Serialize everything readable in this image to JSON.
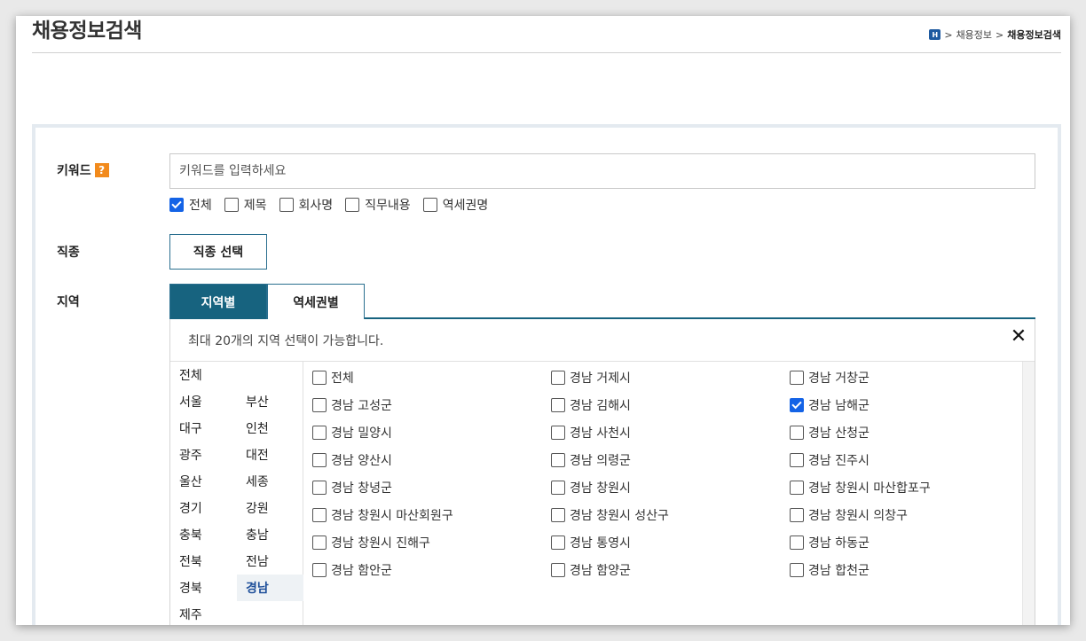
{
  "page_title": "채용정보검색",
  "breadcrumb": {
    "home_glyph": "H",
    "items": [
      "채용정보",
      "채용정보검색"
    ]
  },
  "keyword": {
    "label": "키워드",
    "help_glyph": "?",
    "placeholder": "키워드를 입력하세요",
    "options": [
      {
        "label": "전체",
        "checked": true
      },
      {
        "label": "제목",
        "checked": false
      },
      {
        "label": "회사명",
        "checked": false
      },
      {
        "label": "직무내용",
        "checked": false
      },
      {
        "label": "역세권명",
        "checked": false
      }
    ]
  },
  "job": {
    "label": "직종",
    "button_label": "직종 선택"
  },
  "region": {
    "label": "지역",
    "tabs": [
      {
        "label": "지역별",
        "active": true
      },
      {
        "label": "역세권별",
        "active": false
      }
    ],
    "notice": "최대 20개의 지역 선택이 가능합니다.",
    "close_glyph": "✕",
    "sido": [
      "전체",
      "서울",
      "부산",
      "대구",
      "인천",
      "광주",
      "대전",
      "울산",
      "세종",
      "경기",
      "강원",
      "충북",
      "충남",
      "전북",
      "전남",
      "경북",
      "경남",
      "제주"
    ],
    "selected_sido": "경남",
    "districts": [
      {
        "label": "전체",
        "checked": false
      },
      {
        "label": "경남 거제시",
        "checked": false
      },
      {
        "label": "경남 거창군",
        "checked": false
      },
      {
        "label": "경남 고성군",
        "checked": false
      },
      {
        "label": "경남 김해시",
        "checked": false
      },
      {
        "label": "경남 남해군",
        "checked": true
      },
      {
        "label": "경남 밀양시",
        "checked": false
      },
      {
        "label": "경남 사천시",
        "checked": false
      },
      {
        "label": "경남 산청군",
        "checked": false
      },
      {
        "label": "경남 양산시",
        "checked": false
      },
      {
        "label": "경남 의령군",
        "checked": false
      },
      {
        "label": "경남 진주시",
        "checked": false
      },
      {
        "label": "경남 창녕군",
        "checked": false
      },
      {
        "label": "경남 창원시",
        "checked": false
      },
      {
        "label": "경남 창원시 마산합포구",
        "checked": false
      },
      {
        "label": "경남 창원시 마산회원구",
        "checked": false
      },
      {
        "label": "경남 창원시 성산구",
        "checked": false
      },
      {
        "label": "경남 창원시 의창구",
        "checked": false
      },
      {
        "label": "경남 창원시 진해구",
        "checked": false
      },
      {
        "label": "경남 통영시",
        "checked": false
      },
      {
        "label": "경남 하동군",
        "checked": false
      },
      {
        "label": "경남 함안군",
        "checked": false
      },
      {
        "label": "경남 함양군",
        "checked": false
      },
      {
        "label": "경남 합천군",
        "checked": false
      }
    ]
  }
}
